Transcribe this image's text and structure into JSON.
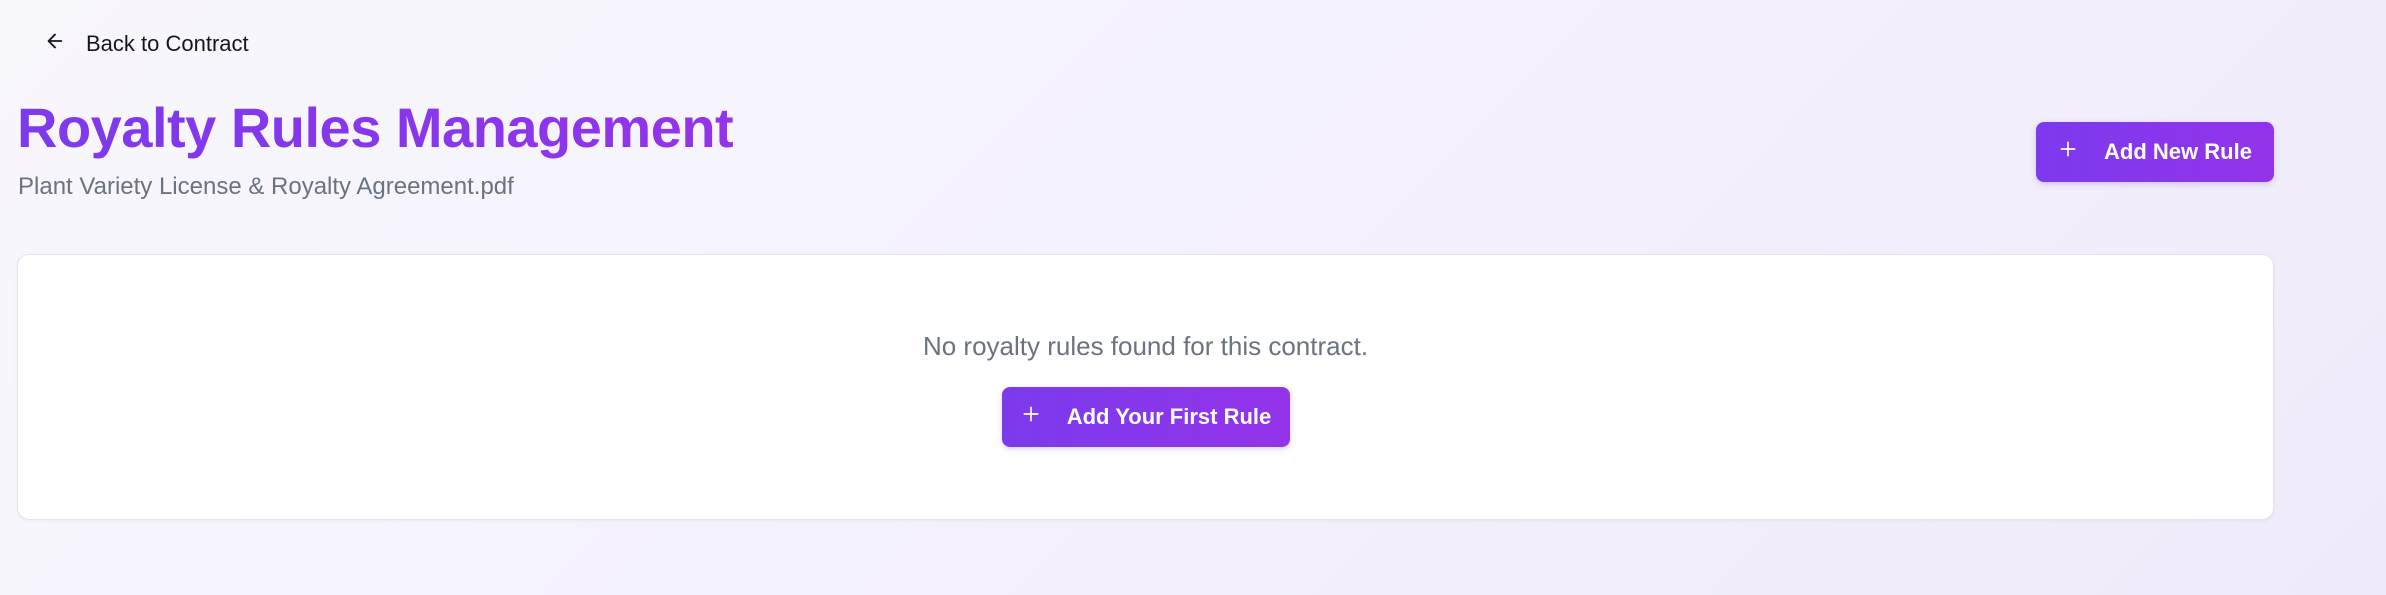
{
  "nav": {
    "back_label": "Back to Contract",
    "back_icon": "arrow-left-icon"
  },
  "header": {
    "title": "Royalty Rules Management",
    "subtitle": "Plant Variety License & Royalty Agreement.pdf",
    "add_button_label": "Add New Rule",
    "add_button_icon": "plus-icon"
  },
  "empty_state": {
    "message": "No royalty rules found for this contract.",
    "button_label": "Add Your First Rule",
    "button_icon": "plus-icon"
  },
  "colors": {
    "accent_start": "#7c3aed",
    "accent_end": "#9333ea",
    "muted_text": "#6b7280",
    "background": "#f5f3fb"
  }
}
